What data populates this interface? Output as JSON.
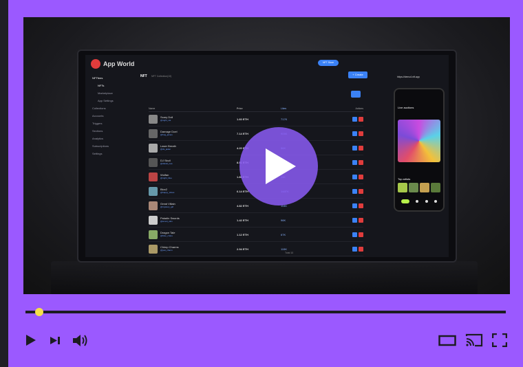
{
  "player": {
    "progress_fraction": 0.02,
    "accent_color": "#9b59ff",
    "knob_color": "#f5e04a"
  },
  "app": {
    "logo": "App World",
    "topbar_pill": "NFT Store",
    "page_title": "NFT",
    "page_subtitle": "NFT Collection(10)",
    "create_label": "+ Create",
    "sidebar": [
      {
        "label": "NFTfees",
        "active": true
      },
      {
        "label": "NFTs",
        "active": true,
        "sub": true
      },
      {
        "label": "Marketplace",
        "sub": true
      },
      {
        "label": "App Settings",
        "sub": true
      },
      {
        "label": "Collections"
      },
      {
        "label": "Accounts"
      },
      {
        "label": "Triggers"
      },
      {
        "label": "Sections"
      },
      {
        "label": "Analytics"
      },
      {
        "label": "Subscriptions"
      },
      {
        "label": "Settings"
      }
    ],
    "table_headers": [
      "Name",
      "Price",
      "Likes",
      "Actions"
    ],
    "rows": [
      {
        "name": "Scary Doll",
        "user": "@night_cat",
        "price": "1.60 ETH",
        "likes": "717K"
      },
      {
        "name": "Damage Doel",
        "user": "@hug_james",
        "price": "7.14 ETH",
        "likes": "905K"
      },
      {
        "name": "Laser Breath",
        "user": "@ds_jaden",
        "price": "4.20 ETH",
        "likes": "56K"
      },
      {
        "name": "DJ Skull",
        "user": "@dskull_nea",
        "price": "8.91 ETH",
        "likes": "52K"
      },
      {
        "name": "Wulfan",
        "user": "@night_blue",
        "price": "1.80 ETH",
        "likes": "11K"
      },
      {
        "name": "Blox2",
        "user": "@happy_slices",
        "price": "6.14 ETH",
        "likes": "148TK"
      },
      {
        "name": "Great Villain",
        "user": "@mystery_girl",
        "price": "4.82 ETH",
        "likes": "114K"
      },
      {
        "name": "Paladin Swords",
        "user": "@smart_skin",
        "price": "1.42 ETH",
        "likes": "96K"
      },
      {
        "name": "Dragon Tale",
        "user": "@blue_crane",
        "price": "1.12 ETH",
        "likes": "67K"
      },
      {
        "name": "Chimp Charms",
        "user": "@just_charm",
        "price": "2.94 ETH",
        "likes": "115K"
      }
    ],
    "pager": "Total 10",
    "phone": {
      "url": "https://demo4.nft.app",
      "section1": "Live auctions",
      "section2": "Top artists"
    }
  }
}
